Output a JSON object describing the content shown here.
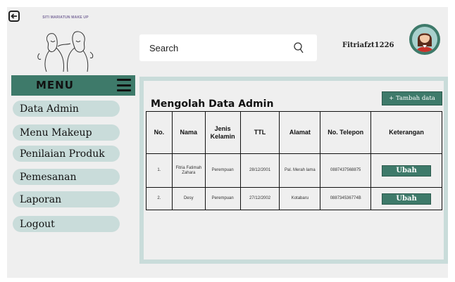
{
  "brand": {
    "logo_text": "SITI MARIATUN MAKE UP"
  },
  "header": {
    "search_placeholder": "Search",
    "username": "Fitriafzt1226"
  },
  "sidebar": {
    "menu_title": "MENU",
    "items": [
      {
        "label": "Data Admin"
      },
      {
        "label": "Menu Makeup"
      },
      {
        "label": "Penilaian Produk"
      },
      {
        "label": "Pemesanan"
      },
      {
        "label": "Laporan"
      },
      {
        "label": "Logout"
      }
    ]
  },
  "main": {
    "title": "Mengolah Data Admin",
    "add_button": "+ Tambah data",
    "table": {
      "headers": [
        "No.",
        "Nama",
        "Jenis Kelamin",
        "TTL",
        "Alamat",
        "No. Telepon",
        "Keterangan"
      ],
      "rows": [
        {
          "no": "1.",
          "nama": "Fitria Fatimah Zahara",
          "jk": "Perempuan",
          "ttl": "28/12/2001",
          "alamat": "Pal. Merah lama",
          "telp": "0887437568875",
          "action": "Ubah"
        },
        {
          "no": "2.",
          "nama": "Desy",
          "jk": "Perempuan",
          "ttl": "27/12/2002",
          "alamat": "Kotabaru",
          "telp": "088734536774B",
          "action": "Ubah"
        }
      ]
    }
  },
  "colors": {
    "accent": "#3e7a6a",
    "pill": "#c9dcda",
    "background": "#efefef"
  },
  "icons": {
    "back": "back-arrow-icon",
    "search": "search-icon",
    "menu": "hamburger-icon"
  }
}
